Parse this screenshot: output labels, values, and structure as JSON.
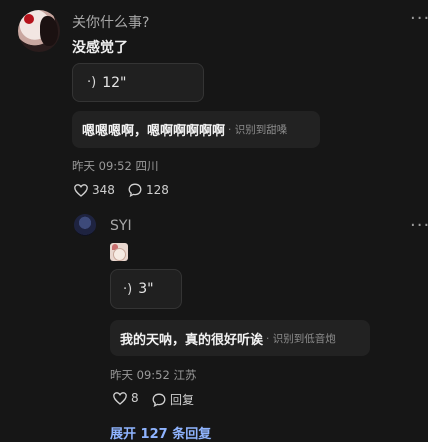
{
  "comment": {
    "author": "关你什么事?",
    "text": "没感觉了",
    "voice_duration": "12\"",
    "transcript": "嗯嗯嗯啊，嗯啊啊啊啊啊",
    "transcript_tag": "· 识别到甜嗓",
    "time": "昨天 09:52",
    "location": "四川",
    "likes": "348",
    "replies": "128"
  },
  "reply": {
    "author": "SYI",
    "voice_duration": "3\"",
    "transcript": "我的天呐，真的很好听诶",
    "transcript_tag": "· 识别到低音炮",
    "time": "昨天 09:52",
    "location": "江苏",
    "likes": "8",
    "reply_label": "回复"
  },
  "expand_label": "展开 127 条回复",
  "icons": {
    "more": "more-dots-icon",
    "voice": "sound-wave-icon",
    "like": "heart-icon",
    "comment": "comment-bubble-icon"
  },
  "colors": {
    "background": "#161616",
    "accent_link": "#8fb4ff"
  }
}
